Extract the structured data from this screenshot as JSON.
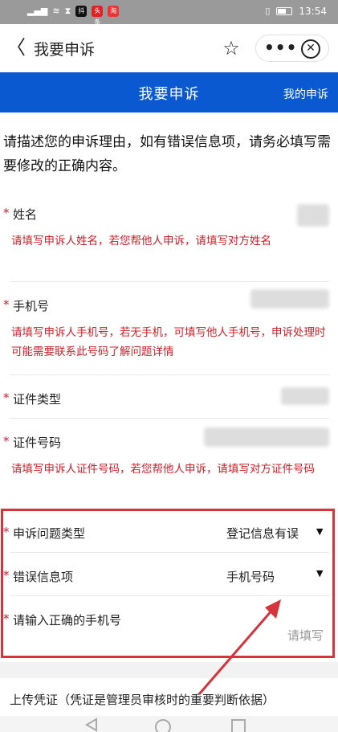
{
  "status_bar": {
    "time": "13:54",
    "app_badges": [
      "抖",
      "头条",
      "淘"
    ]
  },
  "title_bar": {
    "back_glyph": "〈",
    "title": "我要申诉",
    "star_glyph": "☆",
    "more_glyph": "•••",
    "close_glyph": "✕"
  },
  "header": {
    "title": "我要申诉",
    "my_appeals": "我的申诉"
  },
  "intro": "请描述您的申诉理由，如有错误信息项，请务必填写需要修改的正确内容。",
  "required_mark": "*",
  "fields": {
    "name": {
      "label": "姓名",
      "hint": "请填写申诉人姓名，若您帮他人申诉，请填写对方姓名"
    },
    "phone": {
      "label": "手机号",
      "hint": "请填写申诉人手机号，若无手机，可填写他人手机号，申诉处理时可能需要联系此号码了解问题详情"
    },
    "id_type": {
      "label": "证件类型"
    },
    "id_number": {
      "label": "证件号码",
      "hint": "请填写申诉人证件号码，若您帮他人申诉，请填写对方证件号码"
    },
    "issue_type": {
      "label": "申诉问题类型",
      "value": "登记信息有误"
    },
    "error_item": {
      "label": "错误信息项",
      "value": "手机号码"
    },
    "correct_phone": {
      "label": "请输入正确的手机号",
      "placeholder": "请填写"
    }
  },
  "dropdown_glyph": "▼",
  "upload": {
    "label": "上传凭证（凭证是管理员审核时的重要判断依据）"
  },
  "colors": {
    "accent_blue": "#0a59d0",
    "required_red": "#d0202a",
    "highlight_red": "#d6333c"
  }
}
